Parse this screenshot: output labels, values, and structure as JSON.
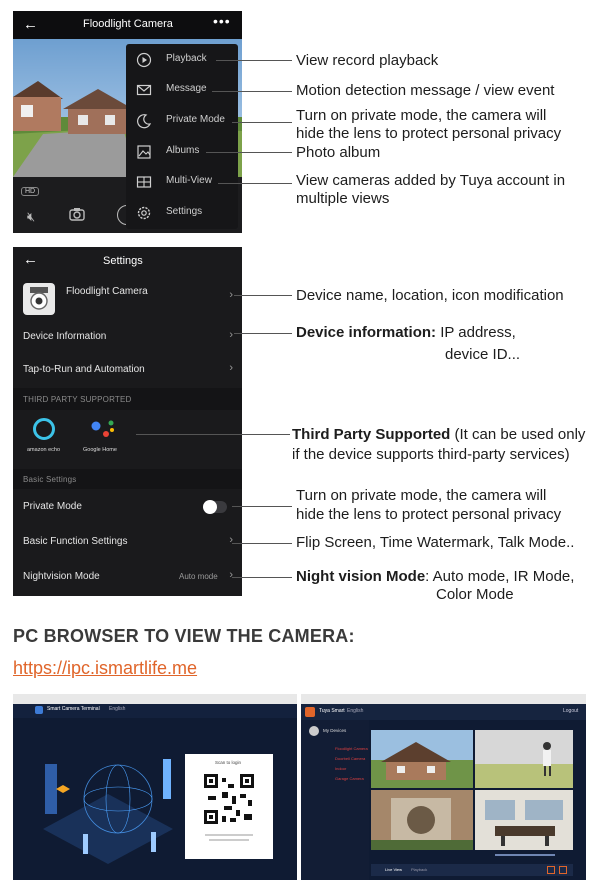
{
  "phone_top": {
    "title": "Floodlight Camera",
    "back_icon": "arrow-left-icon",
    "more_icon": "ellipsis-icon",
    "hd_badge": "HD",
    "menu": [
      {
        "label": "Playback",
        "icon": "playback-icon"
      },
      {
        "label": "Message",
        "icon": "message-icon"
      },
      {
        "label": "Private Mode",
        "icon": "moon-icon"
      },
      {
        "label": "Albums",
        "icon": "albums-icon"
      },
      {
        "label": "Multi-View",
        "icon": "multiview-icon"
      },
      {
        "label": "Settings",
        "icon": "settings-icon"
      }
    ]
  },
  "annotations_top": [
    {
      "text": "View record playback"
    },
    {
      "text": "Motion detection message / view event"
    },
    {
      "line1": "Turn on private mode, the camera will",
      "line2": "hide the lens to protect personal privacy"
    },
    {
      "text": "Photo album"
    },
    {
      "line1": "View cameras added by Tuya account in",
      "line2": "multiple views"
    }
  ],
  "settings_phone": {
    "title": "Settings",
    "device_name": "Floodlight Camera",
    "items": {
      "device_information": "Device Information",
      "tap_to_run": "Tap-to-Run and Automation",
      "third_party_header": "THIRD PARTY SUPPORTED",
      "alexa_label": "amazon echo",
      "google_label": "Google Home",
      "basic_settings_header": "Basic Settings",
      "private_mode": "Private Mode",
      "basic_function": "Basic Function Settings",
      "nightvision": "Nightvision Mode",
      "nightvision_value": "Auto mode"
    }
  },
  "annotations_settings": {
    "device_name": "Device name, location, icon modification",
    "device_info_bold": "Device information:",
    "device_info_rest": " IP address,",
    "device_info_line2": "device ID...",
    "third_party_bold": "Third Party Supported",
    "third_party_rest": " (It can be used only",
    "third_party_line2": "if the device supports third-party services)",
    "private_line1": "Turn on private mode, the camera will",
    "private_line2": "hide the lens to protect personal privacy",
    "basic_function": "Flip Screen, Time Watermark, Talk Mode..",
    "night_bold": "Night vision Mode",
    "night_rest": ": Auto mode, IR Mode,",
    "night_line2": "Color Mode"
  },
  "pc_section": {
    "heading": "PC BROWSER TO VIEW THE CAMERA:",
    "url": "https://ipc.ismartlife.me",
    "left_title": "Smart Camera Terminal",
    "left_lang": "English",
    "qr_caption": "Scan to login",
    "right_brand": "Tuya Smart",
    "right_lang": "English",
    "right_logout": "Logout",
    "right_devices": "My Devices",
    "device_list": [
      "Floodlight Camera",
      "Doorbell Camera",
      "Indoor",
      "Garage Camera"
    ],
    "tabs": [
      "Live View",
      "Playback"
    ]
  },
  "colors": {
    "accent_orange": "#e0652a",
    "phone_bg": "#1a1a1c",
    "screen_bg": "#0f1b33"
  }
}
